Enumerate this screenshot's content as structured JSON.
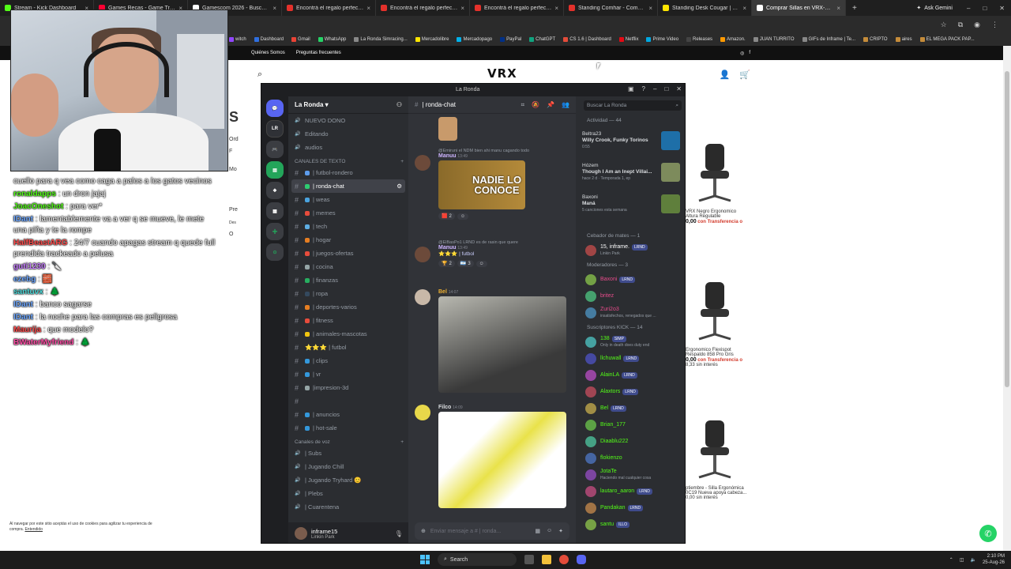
{
  "browser": {
    "tabs": [
      {
        "label": "Stream - Kick Dashboard",
        "color": "#53fc18"
      },
      {
        "label": "Games Recas - Game Trailers",
        "color": "#ff0033"
      },
      {
        "label": "Gamescom 2026 - Buscar con G",
        "color": "#ffffff"
      },
      {
        "label": "Encontrá el regalo perfecto!",
        "color": "#e4312b"
      },
      {
        "label": "Encontrá el regalo perfecto!",
        "color": "#e4312b"
      },
      {
        "label": "Encontrá el regalo perfecto!",
        "color": "#e4312b"
      },
      {
        "label": "Standing Comhar - Comprar en",
        "color": "#e4312b"
      },
      {
        "label": "Standing Desk Cougar | Merca",
        "color": "#ffe600"
      },
      {
        "label": "Comprar Sillas en VRX-FLEXISP",
        "color": "#ffffff"
      }
    ],
    "ask": "Ask Gemini",
    "bookmarks": [
      "witch",
      "Dashboard",
      "Gmail",
      "WhatsApp",
      "La Ronda Simracing...",
      "Mercadolibre",
      "Mercadopago",
      "PayPal",
      "ChatGPT",
      "CS 1.6 | Dashboard",
      "Netflix",
      "Prime Video",
      "Releases",
      "Amazon.",
      "JUAN TURRITO",
      "GIFs de Inframe | Te...",
      "CRIPTO",
      "aires",
      "EL MEGA PACK PAP..."
    ]
  },
  "site": {
    "nav": [
      "Quiénes Somos",
      "Preguntas frecuentes"
    ],
    "logo": "VRX",
    "left_labels": [
      "S",
      "Ord",
      "F",
      "Mo",
      "Pre",
      "Des",
      "O"
    ],
    "products": [
      {
        "name": "VRX Negro Ergonomico Altura Regulable",
        "price": "0,00",
        "transfer": "con Transferencia o",
        "extra": ""
      },
      {
        "name": "Ergonomico Flexispot Respaldo 858 Pro Gris",
        "price": "0,00",
        "transfer": "con Transferencia o",
        "extra": "8,33 sin interés"
      },
      {
        "name": "ptiembre - Silla Ergonómica 0C19 Nueva apoya cabeza...",
        "price": "",
        "transfer": "",
        "extra": "0,00 sin interés"
      }
    ],
    "cookie": {
      "text": "Al navegar por este sitio aceptás el uso de cookies para agilizar tu experiencia de compra.",
      "link": "Entendido"
    }
  },
  "chat": [
    {
      "user": "",
      "color": "#ffffff",
      "text": "cuello para q vea como caga a palos a los gatos vecinos"
    },
    {
      "user": "ronaldapps",
      "color": "#53fc18",
      "text": ": un dron jajaj"
    },
    {
      "user": "JoacOneshot",
      "color": "#53fc18",
      "text": ": para ver*"
    },
    {
      "user": "IDant",
      "color": "#6fa8ff",
      "text": ": lamentablemente va a ver q se mueve, le mete una piña y te la rompe"
    },
    {
      "user": "HalfBeastARG",
      "color": "#ff4d4d",
      "text": ": 24/7 cuando apagas stream q quede full prendida trackeado a pelusa"
    },
    {
      "user": "guti1230",
      "color": "#c77dff",
      "text": ": 🔪"
    },
    {
      "user": "ezebg",
      "color": "#6fa8ff",
      "text": ": 🧱"
    },
    {
      "user": "santuvx",
      "color": "#4dd9d9",
      "text": ": 🌲"
    },
    {
      "user": "IDant",
      "color": "#6fa8ff",
      "text": ": banco sagarse"
    },
    {
      "user": "IDant",
      "color": "#6fa8ff",
      "text": ": la noche para las compras es peligrosa"
    },
    {
      "user": "Maurija",
      "color": "#ff4d4d",
      "text": ": que modelo?"
    },
    {
      "user": "BWaterMyfriend",
      "color": "#ff4da6",
      "text": ": 🌲"
    }
  ],
  "discord": {
    "title": "La Ronda",
    "server": "La Ronda",
    "channels_top": [
      "NUEVO DONO",
      "Editando",
      "audios"
    ],
    "text_category": "CANALES DE TEXTO",
    "text_channels": [
      {
        "name": "| futbol-rondero",
        "selected": false,
        "dim": false
      },
      {
        "name": "| ronda-chat",
        "selected": true,
        "dim": false
      },
      {
        "name": "| weas",
        "selected": false,
        "dim": false
      },
      {
        "name": "| memes",
        "selected": false,
        "dim": false
      },
      {
        "name": "| tech",
        "selected": false,
        "dim": false
      },
      {
        "name": "| hogar",
        "selected": false,
        "dim": false
      },
      {
        "name": "| juegos-ofertas",
        "selected": false,
        "dim": false
      },
      {
        "name": "| cocina",
        "selected": false,
        "dim": false
      },
      {
        "name": "| finanzas",
        "selected": false,
        "dim": false
      },
      {
        "name": "| ropa",
        "selected": false,
        "dim": false
      },
      {
        "name": "| deportes-varios",
        "selected": false,
        "dim": false
      },
      {
        "name": "| fitness",
        "selected": false,
        "dim": false
      },
      {
        "name": "| animales-mascotas",
        "selected": false,
        "dim": false
      },
      {
        "name": "⭐⭐⭐ | futbol",
        "selected": false,
        "dim": false
      },
      {
        "name": "| clips",
        "selected": false,
        "dim": false
      },
      {
        "name": "| vr",
        "selected": false,
        "dim": false
      },
      {
        "name": "|impresion-3d",
        "selected": false,
        "dim": false
      },
      {
        "name": "",
        "selected": false,
        "dim": true
      },
      {
        "name": "| anuncios",
        "selected": false,
        "dim": false
      },
      {
        "name": "| hot-sale",
        "selected": false,
        "dim": false
      }
    ],
    "voice_category": "Canales de voz",
    "voice_channels": [
      "| Subs",
      "| Jugando Chill",
      "| Jugando Tryhard 😊",
      "| Plebs",
      "| Cuarentena"
    ],
    "user": {
      "name": "inframe15",
      "status": "Linkin Park"
    },
    "channel": "| ronda-chat",
    "search": "Buscar La Ronda",
    "messages": [
      {
        "ref": "@Emiruni el NDM bien ahi manu cagando todo",
        "user": "Manuu",
        "time": "13:49",
        "embed": "NADIE LO CONOCE"
      },
      {
        "ref": "@ElBasPo1 LRND es de rasin que quere",
        "user": "Manuu",
        "time": "13:49",
        "text": "⭐⭐⭐ | futbol"
      },
      {
        "ref": "",
        "user": "Bel",
        "time": "14:07",
        "text": ""
      },
      {
        "ref": "",
        "user": "Filco",
        "time": "14:09",
        "text": ""
      }
    ],
    "reactions": [
      "2",
      "2",
      "3"
    ],
    "input_placeholder": "Enviar mensaje a # | ronda...",
    "activity": {
      "label": "Actividad — 44",
      "items": [
        {
          "title": "Beltra23",
          "body": "Willy Crook, Funky Torinos",
          "meta": "0:55",
          "color": "#1e6fa8"
        },
        {
          "title": "Hózem",
          "body": "Though I Am an Inept Villai...",
          "meta": "hace 2 d · Temporada 1, ep",
          "color": "#7d8b5c"
        },
        {
          "title": "Baxoni",
          "body": "Maná",
          "meta": "5 canciones esta semana",
          "color": "#5f7f3c"
        }
      ]
    },
    "groups": [
      {
        "label": "Cebador de mates — 1",
        "members": [
          {
            "name": "15, inframe.",
            "sub": "Linkin Park",
            "color": "#ffffff",
            "badge": "LRND"
          }
        ]
      },
      {
        "label": "Moderadores — 3",
        "members": [
          {
            "name": "Baxoni",
            "sub": "",
            "color": "#e74c8b",
            "badge": "LRND"
          },
          {
            "name": "britez",
            "sub": "",
            "color": "#e74c8b",
            "badge": ""
          },
          {
            "name": "Zuri2o3",
            "sub": "insatisfechos, renegados que ...",
            "color": "#e74c8b",
            "badge": ""
          }
        ]
      },
      {
        "label": "Suscriptores KICK — 14",
        "members": [
          {
            "name": "138",
            "sub": "Only in death does duty end",
            "color": "#53fc18",
            "badge": "SIMP"
          },
          {
            "name": "llchuwall",
            "sub": "",
            "color": "#53fc18",
            "badge": "LRND"
          },
          {
            "name": "AlainLA",
            "sub": "",
            "color": "#53fc18",
            "badge": "LRND"
          },
          {
            "name": "Alaxtors",
            "sub": "",
            "color": "#53fc18",
            "badge": "LRND"
          },
          {
            "name": "Bel",
            "sub": "",
            "color": "#53fc18",
            "badge": "LRND"
          },
          {
            "name": "Brian_177",
            "sub": "",
            "color": "#53fc18",
            "badge": ""
          },
          {
            "name": "Diaablu222",
            "sub": "",
            "color": "#53fc18",
            "badge": ""
          },
          {
            "name": "flokienzo",
            "sub": "",
            "color": "#53fc18",
            "badge": ""
          },
          {
            "name": "JotaTe",
            "sub": "Haciendo mal cualquier cosa",
            "color": "#53fc18",
            "badge": ""
          },
          {
            "name": "lautaro_aaron",
            "sub": "",
            "color": "#53fc18",
            "badge": "LRND"
          },
          {
            "name": "Pandakan",
            "sub": "",
            "color": "#53fc18",
            "badge": "LRND"
          },
          {
            "name": "santu",
            "sub": "",
            "color": "#53fc18",
            "badge": "ILLO"
          }
        ]
      }
    ]
  },
  "taskbar": {
    "search": "Search",
    "time": "2:10 PM",
    "date": "25-Aug-26"
  }
}
